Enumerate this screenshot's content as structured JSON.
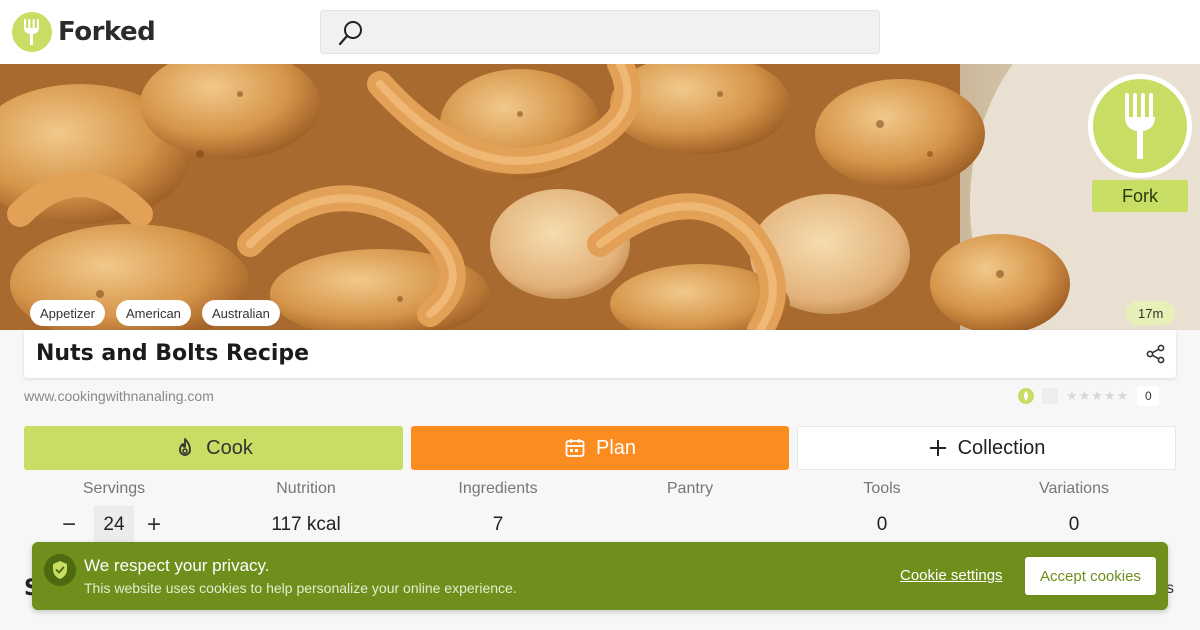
{
  "app": {
    "name": "Forked"
  },
  "header": {
    "search_placeholder": ""
  },
  "hero": {
    "fork_label": "Fork",
    "tags": [
      "Appetizer",
      "American",
      "Australian"
    ],
    "time": "17m"
  },
  "recipe": {
    "title": "Nuts and Bolts Recipe",
    "source": "www.cookingwithnanaling.com",
    "rating_count": "0",
    "stars": "★★★★★"
  },
  "actions": {
    "cook_label": "Cook",
    "plan_label": "Plan",
    "collection_label": "Collection"
  },
  "stats": {
    "servings_label": "Servings",
    "servings_value": "24",
    "minus": "−",
    "plus": "+",
    "nutrition_label": "Nutrition",
    "nutrition_value": "117 kcal",
    "ingredients_label": "Ingredients",
    "ingredients_value": "7",
    "pantry_label": "Pantry",
    "pantry_value": "",
    "tools_label": "Tools",
    "tools_value": "0",
    "variations_label": "Variations",
    "variations_value": "0"
  },
  "behind": {
    "left": "S",
    "right": "s"
  },
  "cookie": {
    "title": "We respect your privacy.",
    "text": "This website uses cookies to help personalize your online experience.",
    "settings_label": "Cookie settings",
    "accept_label": "Accept cookies"
  },
  "colors": {
    "brand_green": "#c7dd63",
    "plan_orange": "#fb8c1f",
    "cookie_green": "#6e8f1c"
  }
}
